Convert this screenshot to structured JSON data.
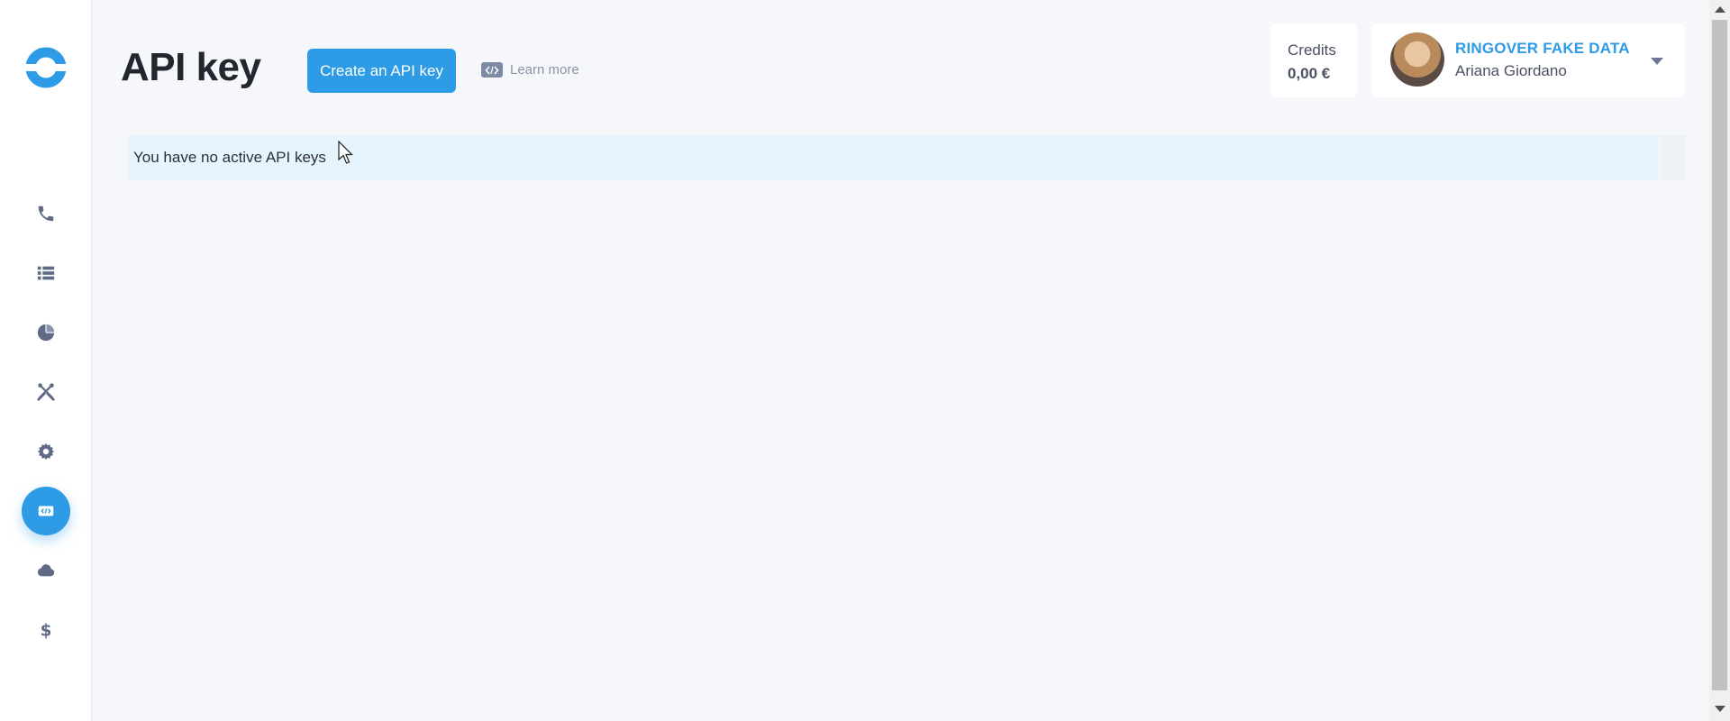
{
  "sidebar": {
    "logo": "ringover-logo",
    "items": [
      {
        "name": "phone-icon",
        "active": false
      },
      {
        "name": "list-icon",
        "active": false
      },
      {
        "name": "pie-chart-icon",
        "active": false
      },
      {
        "name": "tools-icon",
        "active": false
      },
      {
        "name": "gear-icon",
        "active": false
      },
      {
        "name": "code-icon",
        "active": true
      },
      {
        "name": "cloud-icon",
        "active": false
      },
      {
        "name": "dollar-icon",
        "active": false
      }
    ]
  },
  "header": {
    "title": "API key",
    "create_button": "Create an API key",
    "learn_more": "Learn more"
  },
  "credits": {
    "label": "Credits",
    "value": "0,00 €"
  },
  "user": {
    "org_name": "RINGOVER FAKE DATA",
    "name": "Ariana Giordano"
  },
  "main": {
    "notice": "You have no active API keys"
  },
  "colors": {
    "accent": "#2e9be6",
    "background": "#f6f7fa",
    "icon": "#5f6b85",
    "notice_bg": "#e6f4fd"
  }
}
